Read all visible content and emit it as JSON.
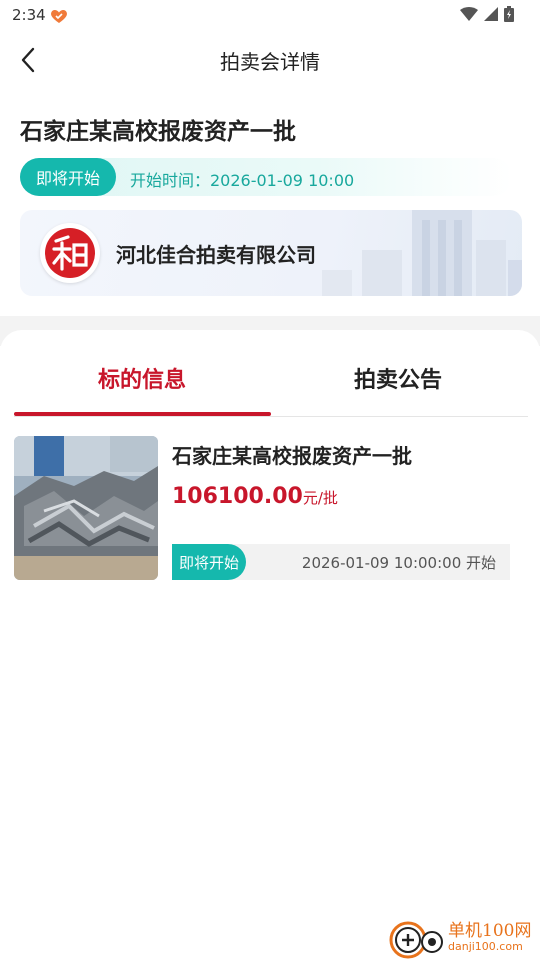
{
  "status_bar": {
    "time": "2:34"
  },
  "header": {
    "title": "拍卖会详情"
  },
  "auction": {
    "title": "石家庄某高校报废资产一批",
    "status": "即将开始",
    "start_time": "开始时间：2026-01-09 10:00",
    "organizer": "河北佳合拍卖有限公司",
    "logo_char": "和"
  },
  "tabs": [
    {
      "label": "标的信息",
      "active": true
    },
    {
      "label": "拍卖公告",
      "active": false
    }
  ],
  "items": [
    {
      "title": "石家庄某高校报废资产一批",
      "price": "106100.00",
      "price_unit": "元/批",
      "status": "即将开始",
      "start": "2026-01-09 10:00:00 开始"
    }
  ],
  "watermark": {
    "name": "单机100网",
    "url": "danji100.com"
  },
  "colors": {
    "accent_red": "#c8162b",
    "teal": "#15b8ad"
  }
}
